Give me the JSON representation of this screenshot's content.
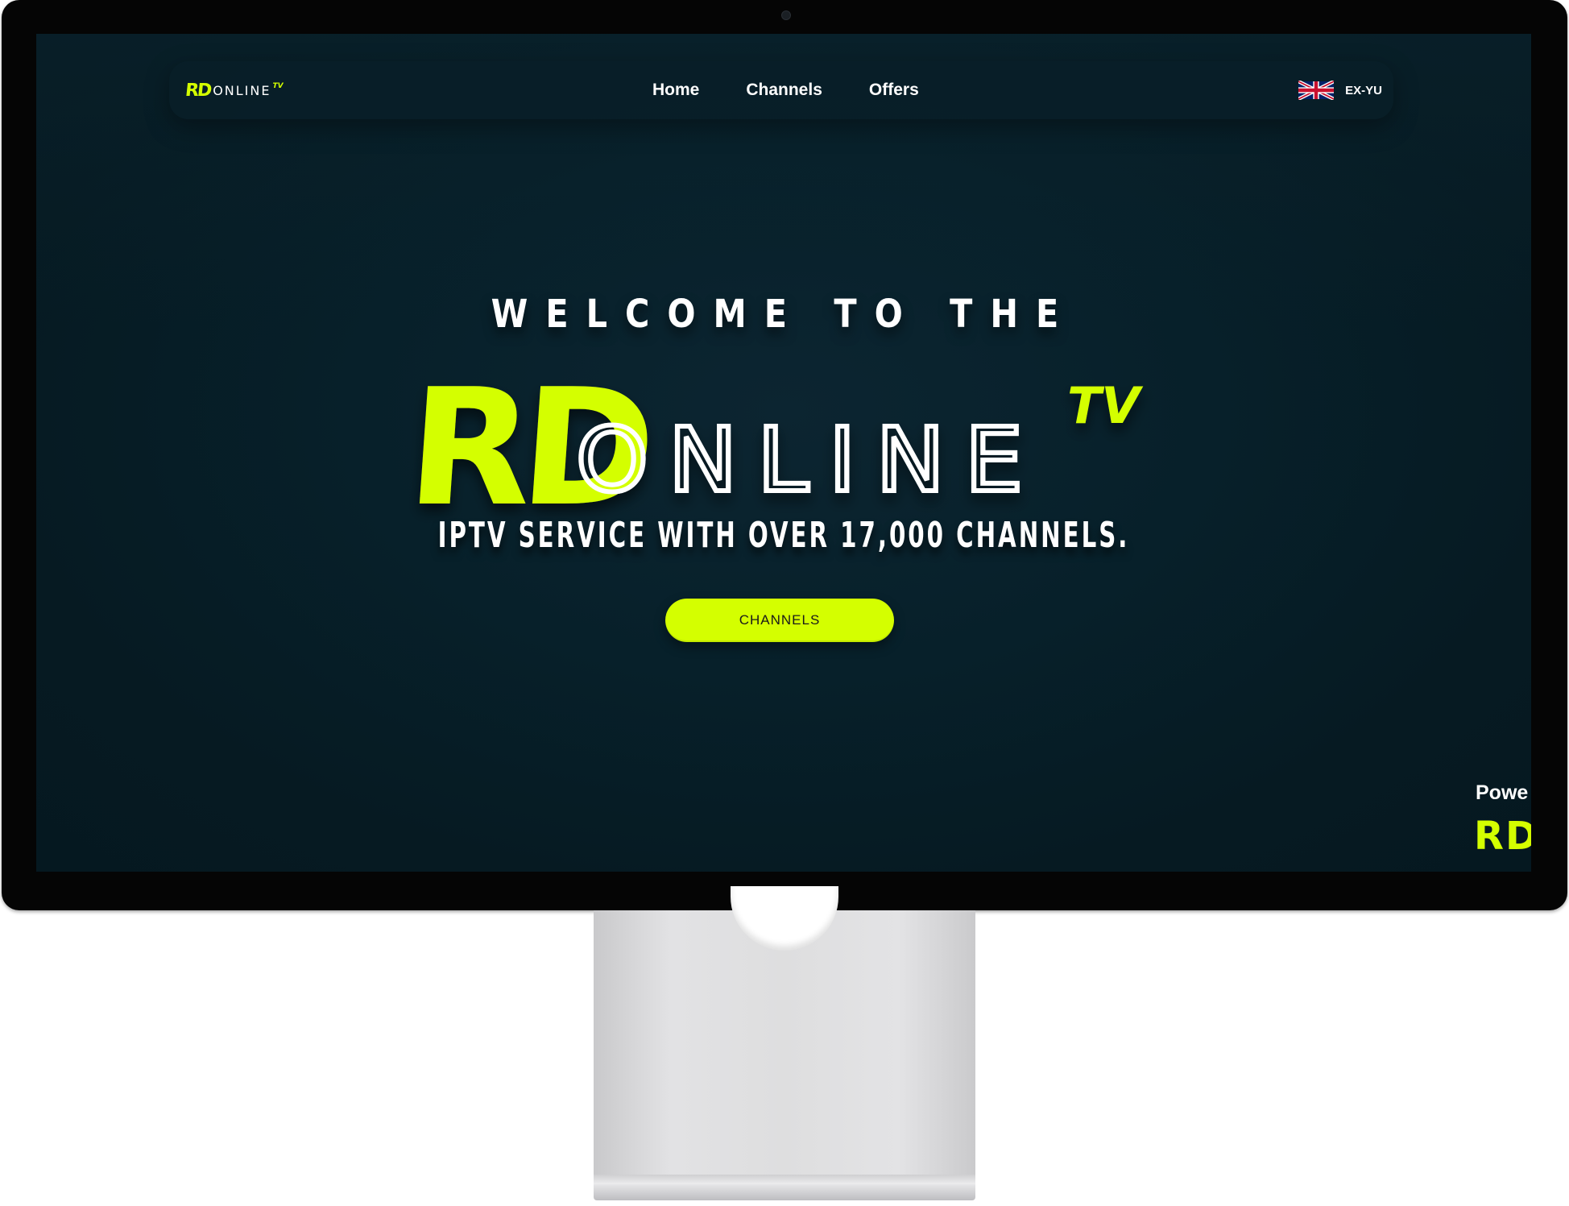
{
  "nav": {
    "logo": {
      "rd": "RD",
      "online": "ONLINE",
      "tv": "TV"
    },
    "links": [
      "Home",
      "Channels",
      "Offers"
    ],
    "language": {
      "label": "EX-YU",
      "flag_icon": "uk-flag-icon"
    }
  },
  "hero": {
    "welcome": "WELCOME TO THE",
    "logo": {
      "rd": "RD",
      "online": "ONLINE",
      "tv": "TV"
    },
    "tagline": "IPTV SERVICE WITH OVER 17,000 CHANNELS.",
    "cta_label": "CHANNELS"
  },
  "footer_peek": {
    "powered_text": "Powe",
    "brand_text": "RD"
  },
  "colors": {
    "accent": "#d4ff00",
    "background": "#061a22",
    "text": "#ffffff"
  }
}
